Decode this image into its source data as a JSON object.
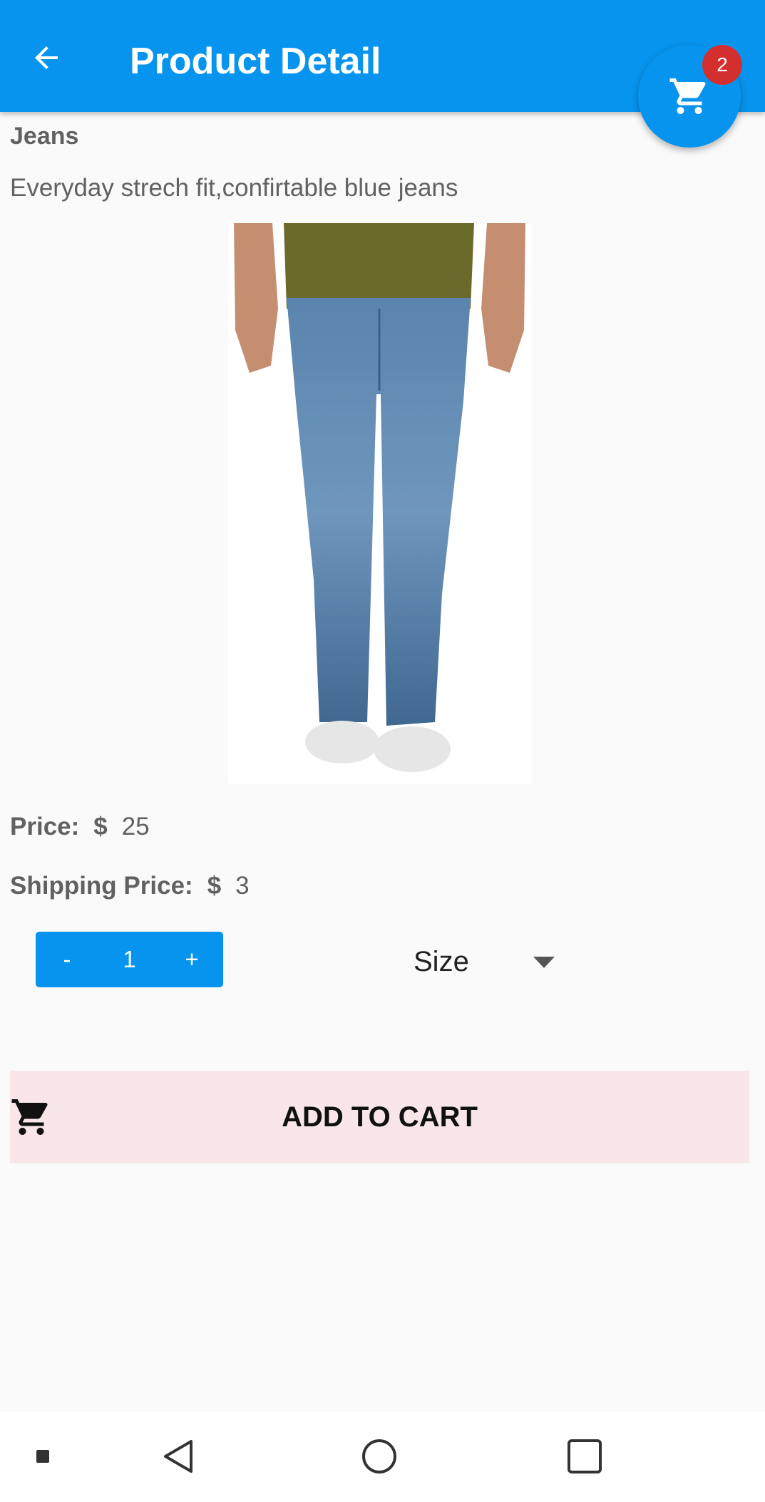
{
  "app_bar": {
    "title": "Product Detail",
    "back_icon": "arrow-back-icon",
    "color": "#0794ee"
  },
  "cart": {
    "icon": "shopping-cart-icon",
    "badge_count": "2",
    "badge_color": "#d32f2f"
  },
  "product": {
    "name": "Jeans",
    "description": "Everyday strech fit,confirtable blue jeans",
    "image": "blue-jeans-product-photo",
    "price_label": "Price:",
    "price_currency": "$",
    "price_value": "25",
    "shipping_label": "Shipping Price:",
    "shipping_currency": "$",
    "shipping_value": "3"
  },
  "quantity": {
    "decrement_label": "-",
    "value": "1",
    "increment_label": "+"
  },
  "size_select": {
    "selected_label": "Size",
    "icon": "dropdown-arrow-icon"
  },
  "add_to_cart": {
    "label": "ADD TO CART",
    "icon": "shopping-cart-icon",
    "background": "#f8e6e8"
  },
  "system_nav": {
    "icons": [
      "small-square-icon",
      "back-triangle-icon",
      "home-circle-icon",
      "recents-square-icon"
    ]
  }
}
